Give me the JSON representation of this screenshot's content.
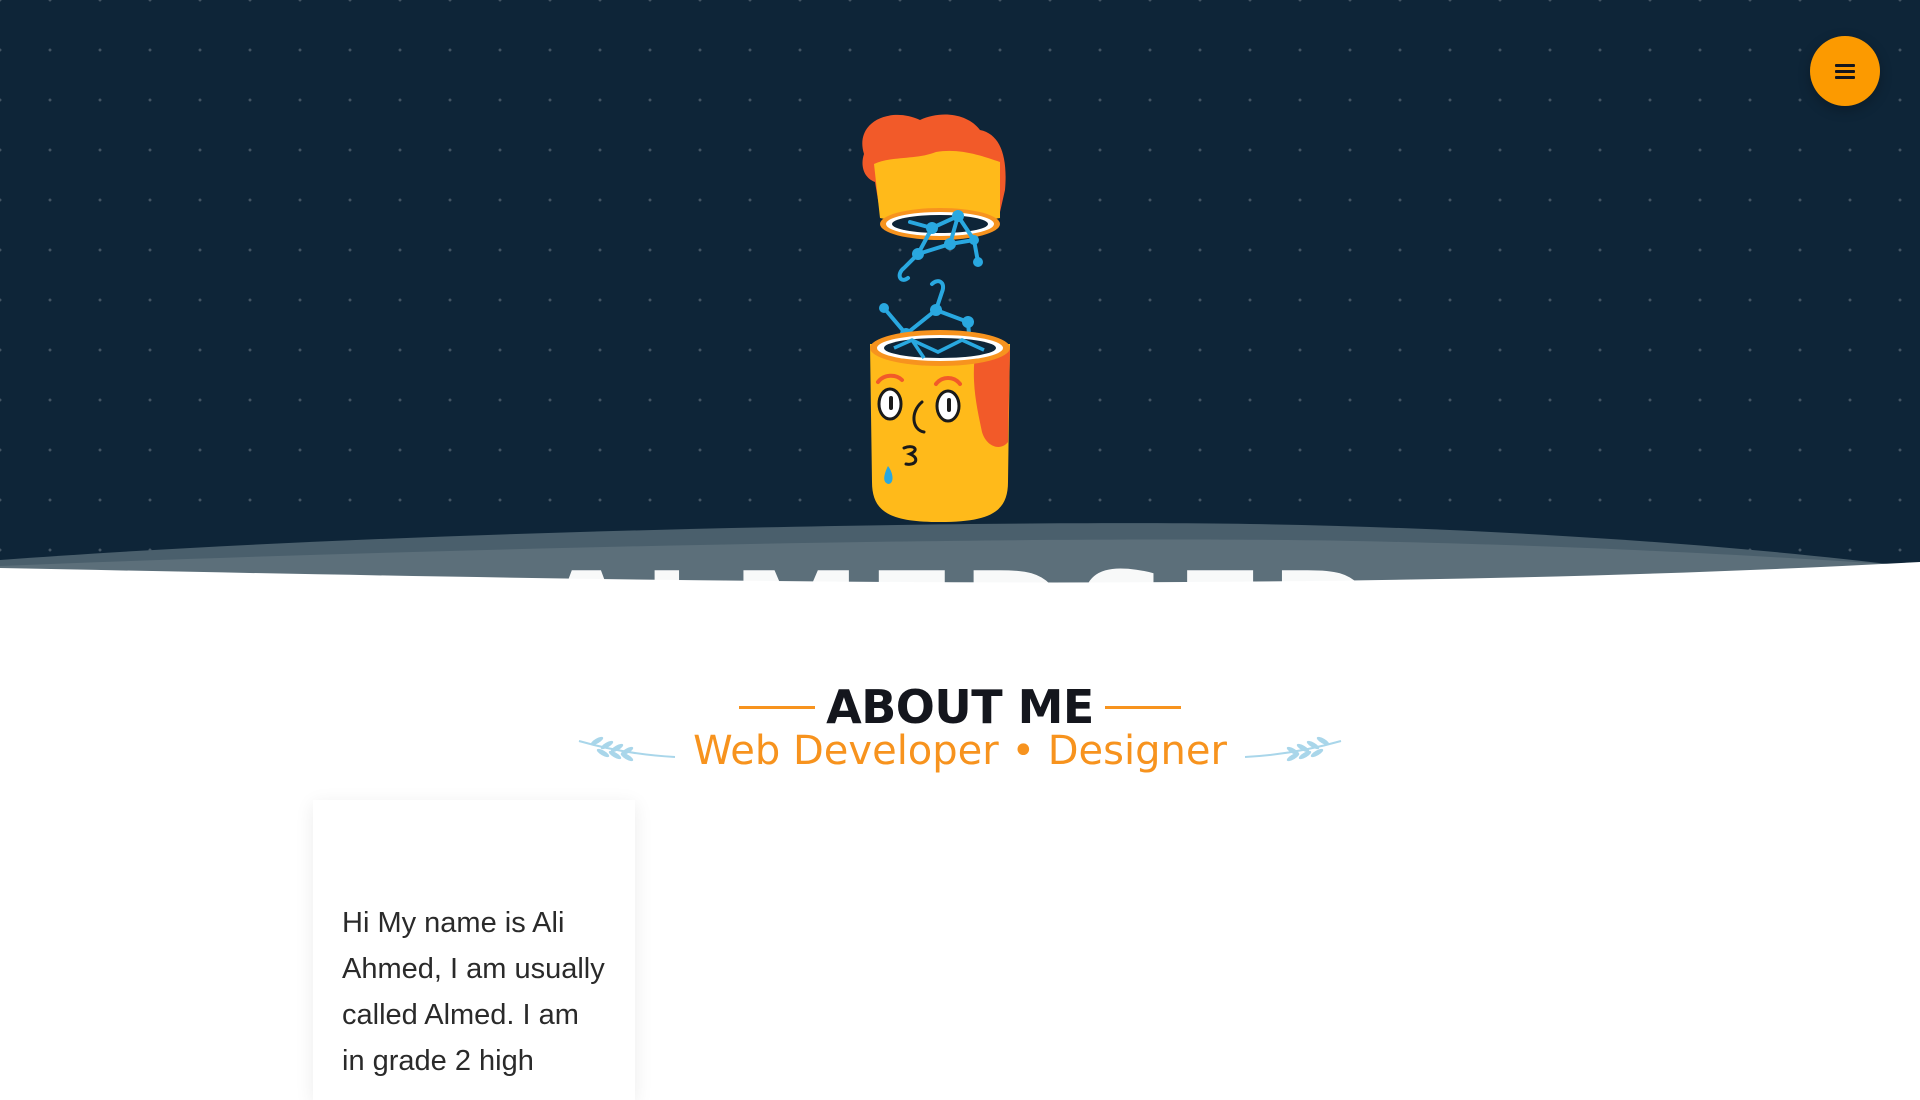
{
  "hero": {
    "background_color": "#0e2538",
    "illustration_icon": "open-head-brain-network-icon",
    "brand_watermark": "ALMEDSED"
  },
  "menu": {
    "icon": "hamburger-menu-icon",
    "accent_color": "#fc9a00"
  },
  "about": {
    "heading": "ABOUT ME",
    "subtitle": "Web Developer • Designer",
    "accent_color": "#f7931e",
    "bio": "Hi My name is Ali Ahmed, I am usually called Almed. I am in grade 2 high"
  }
}
